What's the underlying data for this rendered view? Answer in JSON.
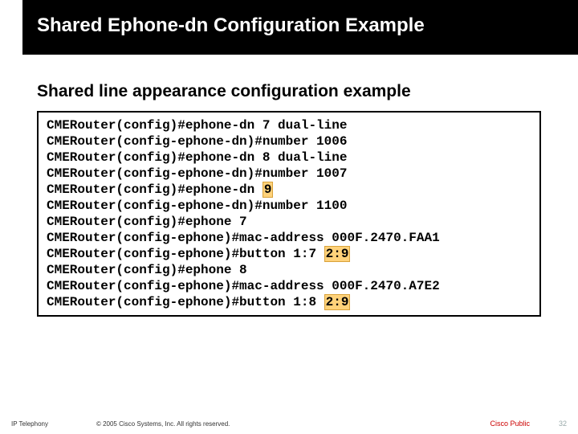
{
  "header": {
    "title": "Shared Ephone-dn Configuration Example"
  },
  "subtitle": "Shared line appearance configuration example",
  "code": {
    "l1_pre": "CMERouter(config)#ephone-dn 7 dual-line",
    "l2_pre": "CMERouter(config-ephone-dn)#number 1006",
    "l3_pre": "CMERouter(config)#ephone-dn 8 dual-line",
    "l4_pre": "CMERouter(config-ephone-dn)#number 1007",
    "l5_pre": "CMERouter(config)#ephone-dn ",
    "l5_hl": "9",
    "l6_pre": "CMERouter(config-ephone-dn)#number 1100",
    "l7_pre": "CMERouter(config)#ephone 7",
    "l8_pre": "CMERouter(config-ephone)#mac-address 000F.2470.FAA1",
    "l9_pre": "CMERouter(config-ephone)#button 1:7 ",
    "l9_hl": "2:9",
    "l10_pre": "CMERouter(config)#ephone 8",
    "l11_pre": "CMERouter(config-ephone)#mac-address 000F.2470.A7E2",
    "l12_pre": "CMERouter(config-ephone)#button 1:8 ",
    "l12_hl": "2:9"
  },
  "footer": {
    "course": "IP Telephony",
    "copyright": "© 2005 Cisco Systems, Inc. All rights reserved.",
    "cisco_public": "Cisco Public",
    "pagenum": "32"
  }
}
